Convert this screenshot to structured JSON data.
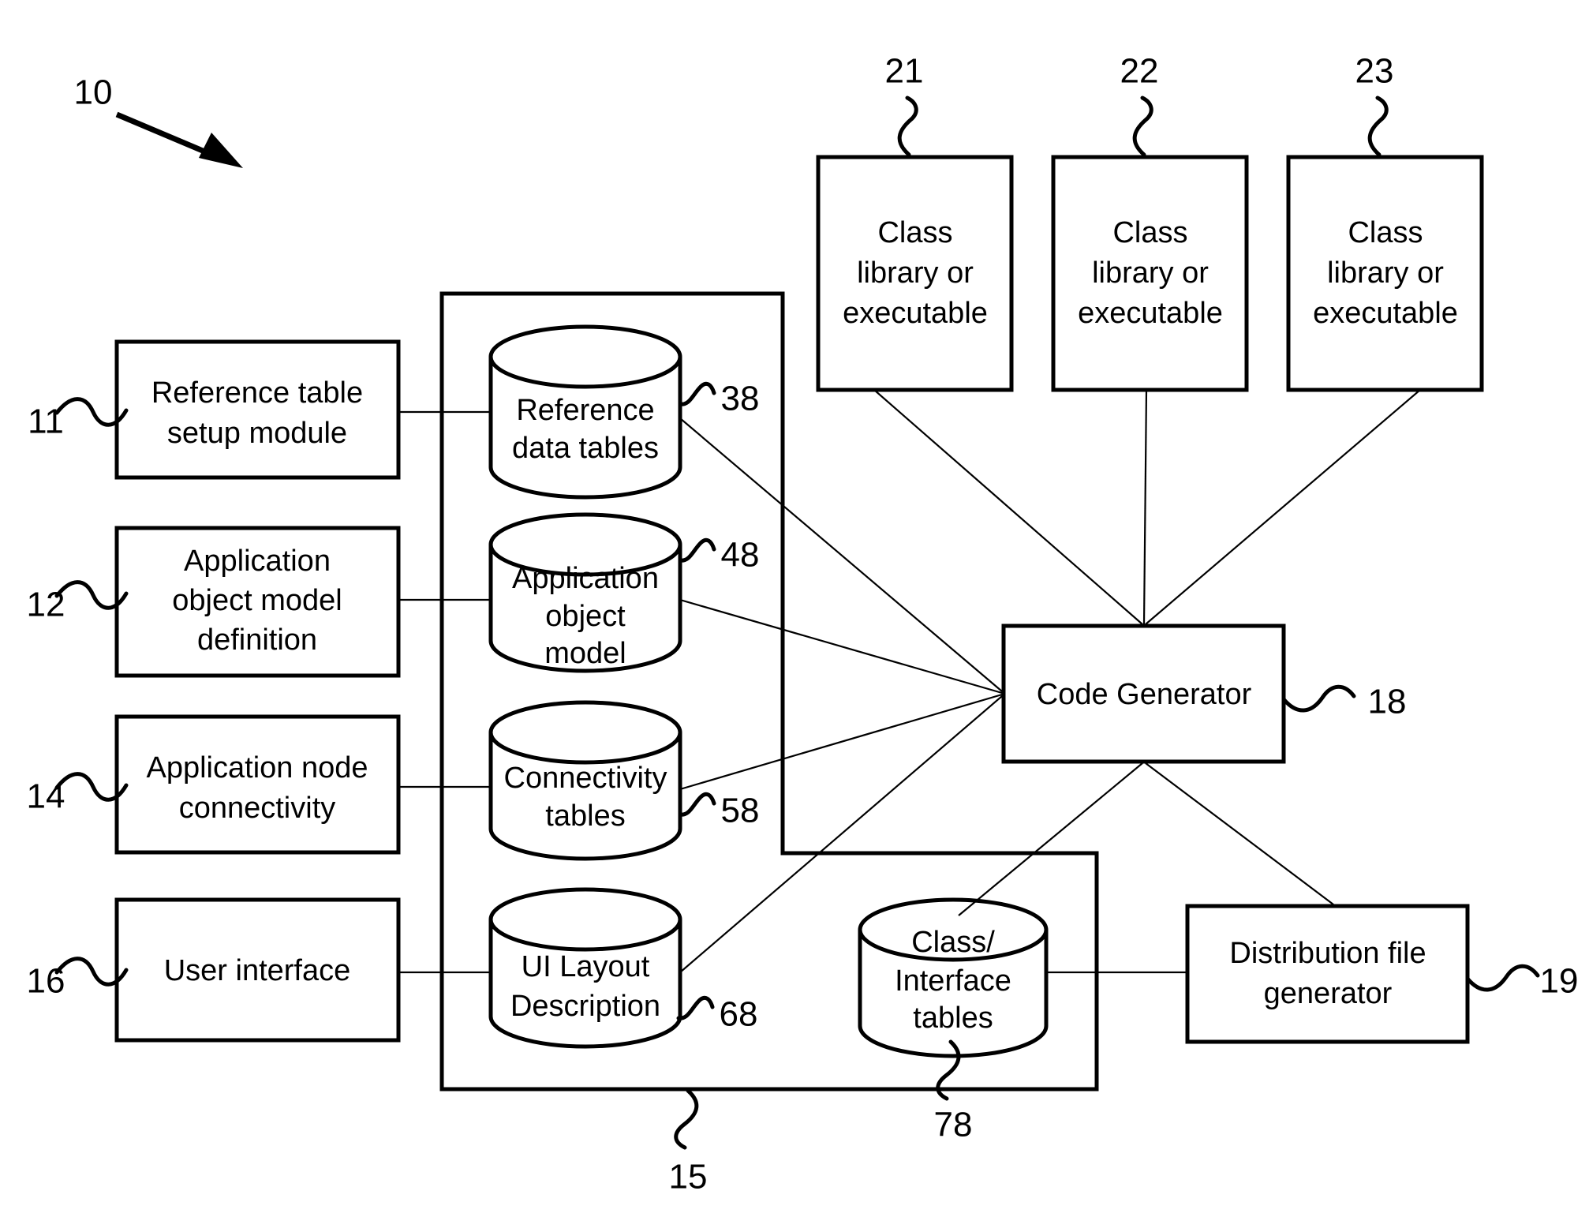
{
  "figure": {
    "title": "System architecture block diagram",
    "figure_reference": "10"
  },
  "reference_numerals": {
    "system": "10",
    "reference_table_setup_module": "11",
    "application_object_model_definition": "12",
    "application_node_connectivity": "14",
    "repository_container": "15",
    "user_interface": "16",
    "code_generator": "18",
    "distribution_file_generator": "19",
    "class_library_1": "21",
    "class_library_2": "22",
    "class_library_3": "23",
    "reference_data_tables": "38",
    "application_object_model": "48",
    "connectivity_tables": "58",
    "ui_layout_description": "68",
    "class_interface_tables": "78"
  },
  "left_modules": [
    {
      "id": "reference-table-setup-module",
      "lines": [
        "Reference table",
        "setup module"
      ],
      "numeral": "11"
    },
    {
      "id": "application-object-model-definition",
      "lines": [
        "Application",
        "object model",
        "definition"
      ],
      "numeral": "12"
    },
    {
      "id": "application-node-connectivity",
      "lines": [
        "Application node",
        "connectivity"
      ],
      "numeral": "14"
    },
    {
      "id": "user-interface",
      "lines": [
        "User interface"
      ],
      "numeral": "16"
    }
  ],
  "datastores": [
    {
      "id": "reference-data-tables",
      "lines": [
        "Reference",
        "data tables"
      ],
      "numeral": "38"
    },
    {
      "id": "application-object-model",
      "lines": [
        "Application",
        "object",
        "model"
      ],
      "numeral": "48"
    },
    {
      "id": "connectivity-tables",
      "lines": [
        "Connectivity",
        "tables"
      ],
      "numeral": "58"
    },
    {
      "id": "ui-layout-description",
      "lines": [
        "UI Layout",
        "Description"
      ],
      "numeral": "68"
    },
    {
      "id": "class-interface-tables",
      "lines": [
        "Class/",
        "Interface",
        "tables"
      ],
      "numeral": "78"
    }
  ],
  "class_libraries": [
    {
      "id": "class-library-1",
      "lines": [
        "Class",
        "library or",
        "executable"
      ],
      "numeral": "21"
    },
    {
      "id": "class-library-2",
      "lines": [
        "Class",
        "library or",
        "executable"
      ],
      "numeral": "22"
    },
    {
      "id": "class-library-3",
      "lines": [
        "Class",
        "library or",
        "executable"
      ],
      "numeral": "23"
    }
  ],
  "processors": [
    {
      "id": "code-generator",
      "lines": [
        "Code Generator"
      ],
      "numeral": "18"
    },
    {
      "id": "distribution-file-generator",
      "lines": [
        "Distribution file",
        "generator"
      ],
      "numeral": "19"
    }
  ],
  "text": {
    "t_reference_table_1": "Reference table",
    "t_reference_table_2": "setup module",
    "t_appobj_1": "Application",
    "t_appobj_2": "object model",
    "t_appobj_3": "definition",
    "t_appnode_1": "Application node",
    "t_appnode_2": "connectivity",
    "t_userif_1": "User interface",
    "t_refdata_1": "Reference",
    "t_refdata_2": "data tables",
    "t_aom_1": "Application",
    "t_aom_2": "object",
    "t_aom_3": "model",
    "t_conn_1": "Connectivity",
    "t_conn_2": "tables",
    "t_uilayout_1": "UI Layout",
    "t_uilayout_2": "Description",
    "t_classif_1": "Class/",
    "t_classif_2": "Interface",
    "t_classif_3": "tables",
    "t_cl1_1": "Class",
    "t_cl1_2": "library or",
    "t_cl1_3": "executable",
    "t_cl2_1": "Class",
    "t_cl2_2": "library or",
    "t_cl2_3": "executable",
    "t_cl3_1": "Class",
    "t_cl3_2": "library or",
    "t_cl3_3": "executable",
    "t_codegen": "Code Generator",
    "t_distfile_1": "Distribution file",
    "t_distfile_2": "generator",
    "n_10": "10",
    "n_11": "11",
    "n_12": "12",
    "n_14": "14",
    "n_15": "15",
    "n_16": "16",
    "n_18": "18",
    "n_19": "19",
    "n_21": "21",
    "n_22": "22",
    "n_23": "23",
    "n_38": "38",
    "n_48": "48",
    "n_58": "58",
    "n_68": "68",
    "n_78": "78"
  },
  "colors": {
    "stroke": "#000000",
    "background": "#ffffff"
  }
}
